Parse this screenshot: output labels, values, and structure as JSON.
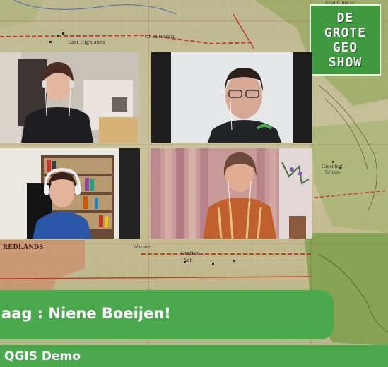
{
  "map": {
    "labels": {
      "east_highlands": "East Highlands",
      "greenspot": "GREENSPOT",
      "sean_conway": "Sean Conway",
      "redlands": "REDLANDS",
      "warner": "Warner",
      "crafton": "Crafton",
      "sch": "Sch",
      "greenleaf": "Greenleaf",
      "school": "School"
    }
  },
  "logo": {
    "line1": "DE",
    "line2": "GROTE",
    "line3": "GEO",
    "line4": "SHOW",
    "bg_color": "#3f9a3f"
  },
  "participants": [
    {
      "tile": 1,
      "description": "Woman with headphones in a room with bookshelf"
    },
    {
      "tile": 2,
      "description": "Man with glasses and earphones"
    },
    {
      "tile": 3,
      "description": "Woman with headphones in front of a bookcase"
    },
    {
      "tile": 4,
      "description": "Woman with earphones in front of a curtain"
    }
  ],
  "lower_third": {
    "title": "aag : Niene Boeijen!",
    "subtitle": "QGIS Demo",
    "bar_color": "#4aa84d"
  }
}
